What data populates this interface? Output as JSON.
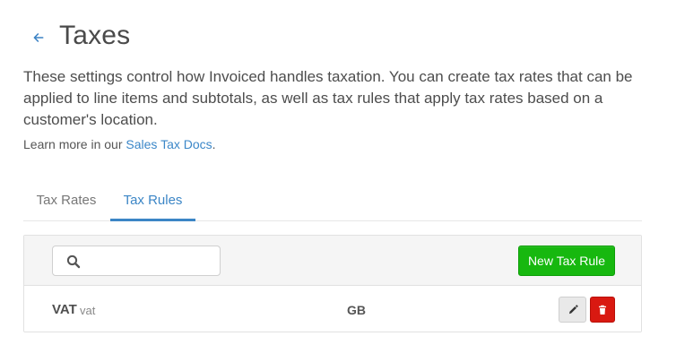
{
  "header": {
    "back_icon": "arrow-left-icon",
    "title": "Taxes"
  },
  "description": {
    "text": "These settings control how Invoiced handles taxation. You can create tax rates that can be applied to line items and subtotals, as well as tax rules that apply tax rates based on a customer's location.",
    "learn_more_prefix": "Learn more in our ",
    "learn_more_link": "Sales Tax Docs",
    "learn_more_suffix": "."
  },
  "tabs": [
    {
      "label": "Tax Rates",
      "active": false
    },
    {
      "label": "Tax Rules",
      "active": true
    }
  ],
  "toolbar": {
    "search_icon": "search-icon",
    "search_value": "",
    "search_placeholder": "",
    "new_button_label": "New Tax Rule",
    "new_button_color": "#17b80f"
  },
  "rules": [
    {
      "name": "VAT",
      "code": "vat",
      "country": "GB",
      "edit_icon": "pencil-icon",
      "delete_icon": "trash-icon"
    }
  ],
  "colors": {
    "link": "#3b87c8",
    "active_tab": "#3c86c6",
    "danger": "#d91911"
  }
}
